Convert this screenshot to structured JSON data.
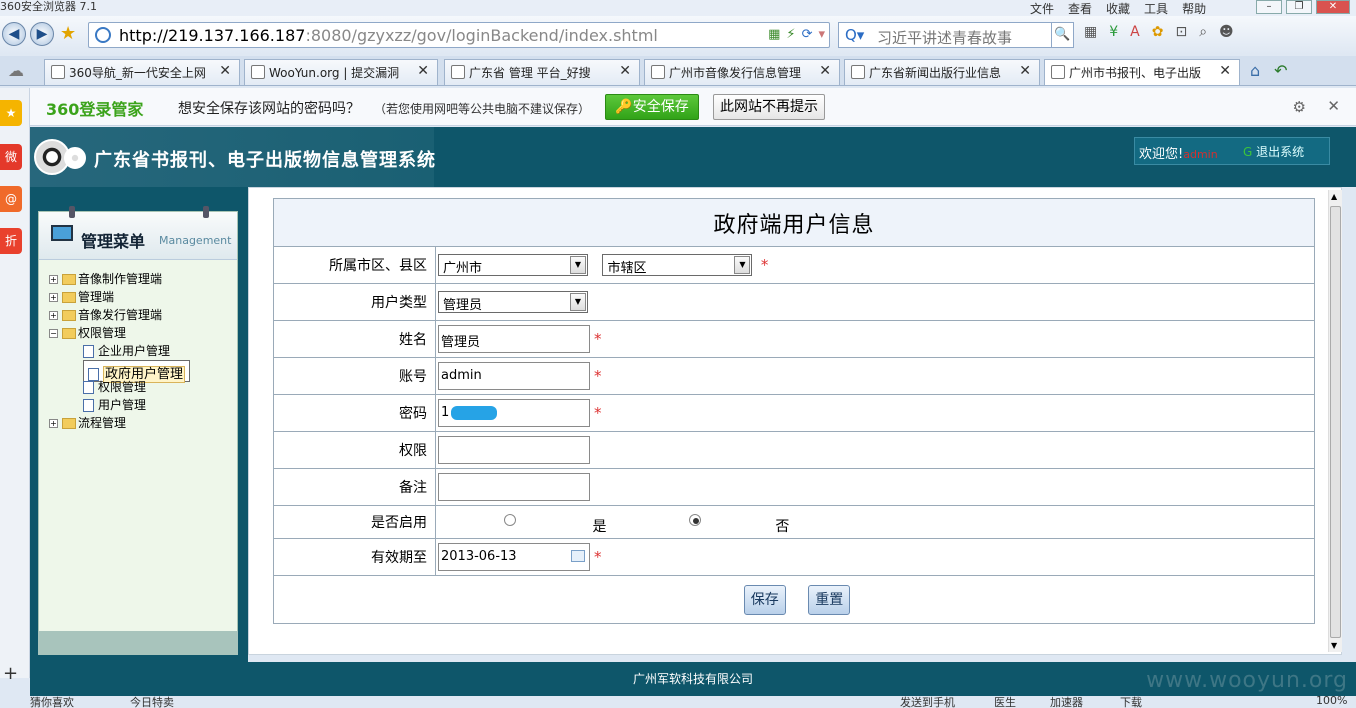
{
  "browser": {
    "title": "360安全浏览器 7.1",
    "menus": [
      "文件",
      "查看",
      "收藏",
      "工具",
      "帮助"
    ],
    "url_host": "http://219.137.166.187",
    "url_path": ":8080/gzyxzz/gov/loginBackend/index.shtml",
    "search_placeholder": "习近平讲述青春故事",
    "tabs": [
      {
        "label": "360导航_新一代安全上网"
      },
      {
        "label": "WooYun.org | 提交漏洞"
      },
      {
        "label": "广东省 管理 平台_好搜"
      },
      {
        "label": "广州市音像发行信息管理"
      },
      {
        "label": "广东省新闻出版行业信息"
      },
      {
        "label": "广州市书报刊、电子出版"
      }
    ],
    "password_bar": {
      "logo": "360登录管家",
      "question": "想安全保存该网站的密码吗？",
      "note": "（若您使用网吧等公共电脑不建议保存）",
      "save": "安全保存",
      "never": "此网站不再提示"
    },
    "left_strip": [
      "★",
      "微",
      "@",
      "折"
    ],
    "status_left": [
      "猜你喜欢",
      "今日特卖"
    ],
    "status_right": [
      "发送到手机",
      "医生",
      "加速器",
      "下载",
      "100%"
    ]
  },
  "app": {
    "title": "广东省书报刊、电子出版物信息管理系统",
    "welcome": "欢迎您!",
    "username": "admin",
    "logout": "退出系统",
    "footer": "广州军软科技有限公司",
    "watermark": "www.wooyun.org"
  },
  "menu": {
    "title": "管理菜单",
    "subtitle": "Management",
    "items": [
      {
        "label": "音像制作管理端"
      },
      {
        "label": "管理端"
      },
      {
        "label": "音像发行管理端"
      },
      {
        "label": "权限管理"
      },
      {
        "label": "企业用户管理"
      },
      {
        "label": "政府用户管理"
      },
      {
        "label": "权限管理"
      },
      {
        "label": "用户管理"
      },
      {
        "label": "流程管理"
      }
    ]
  },
  "form": {
    "title": "政府端用户信息",
    "fields": {
      "region_label": "所属市区、县区",
      "city": "广州市",
      "district": "市辖区",
      "usertype_label": "用户类型",
      "usertype": "管理员",
      "name_label": "姓名",
      "name": "管理员",
      "account_label": "账号",
      "account": "admin",
      "password_label": "密码",
      "password_visible": "1",
      "permission_label": "权限",
      "permission": "",
      "remark_label": "备注",
      "remark": "",
      "enabled_label": "是否启用",
      "yes": "是",
      "no": "否",
      "enabled": "否",
      "expire_label": "有效期至",
      "expire": "2013-06-13"
    },
    "buttons": {
      "save": "保存",
      "reset": "重置"
    },
    "required_mark": "*"
  },
  "colors": {
    "header": "#0e566a",
    "menu_bg": "#eef7ea",
    "required": "#dd3333"
  }
}
